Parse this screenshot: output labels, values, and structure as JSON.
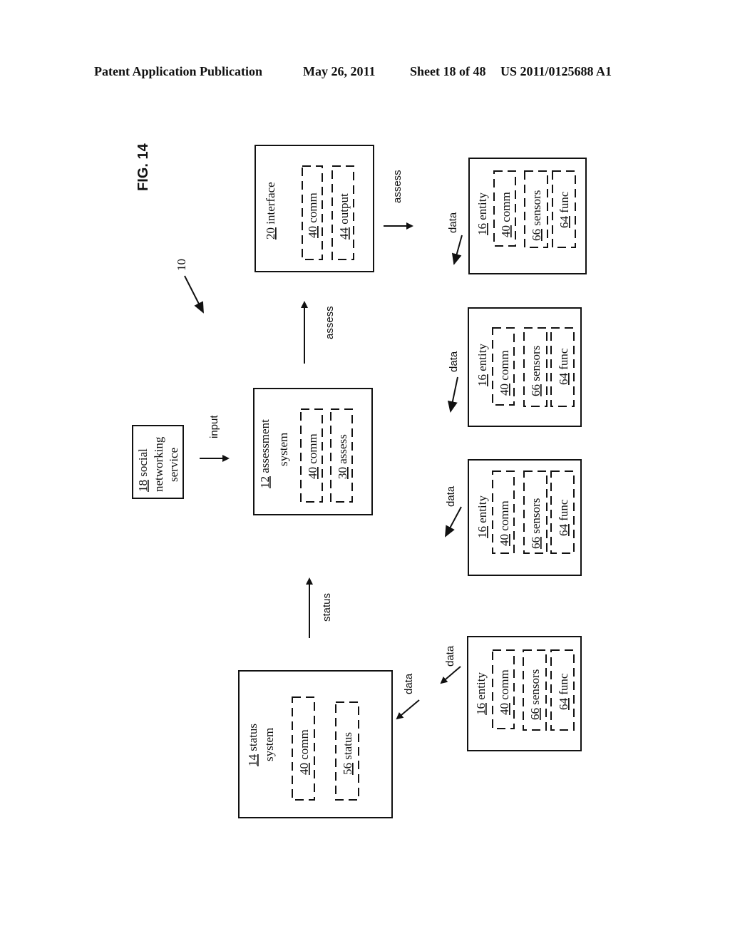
{
  "header": {
    "left": "Patent Application Publication",
    "date": "May 26, 2011",
    "sheet": "Sheet 18 of 48",
    "number": "US 2011/0125688 A1"
  },
  "figure": {
    "label": "FIG. 14",
    "ref": "10"
  },
  "boxes": {
    "interface": {
      "num": "20",
      "text": " interface",
      "subs": [
        {
          "num": "40",
          "text": " comm"
        },
        {
          "num": "44",
          "text": " output"
        }
      ]
    },
    "assessment": {
      "num": "12",
      "text": " assessment",
      "line2": "system",
      "subs": [
        {
          "num": "40",
          "text": " comm"
        },
        {
          "num": "30",
          "text": " assess"
        }
      ]
    },
    "social": {
      "num": "18",
      "text": " social",
      "line2": "networking",
      "line3": "service"
    },
    "status": {
      "num": "14",
      "text": " status",
      "line2": "system",
      "subs": [
        {
          "num": "40",
          "text": " comm"
        },
        {
          "num": "56",
          "text": " status"
        }
      ]
    },
    "entities": [
      {
        "num": "16",
        "text": " entity",
        "subs": [
          {
            "num": "40",
            "text": " comm"
          },
          {
            "num": "66",
            "text": " sensors"
          },
          {
            "num": "64",
            "text": " func"
          }
        ]
      },
      {
        "num": "16",
        "text": " entity",
        "subs": [
          {
            "num": "40",
            "text": " comm"
          },
          {
            "num": "66",
            "text": " sensors"
          },
          {
            "num": "64",
            "text": " func"
          }
        ]
      },
      {
        "num": "16",
        "text": " entity",
        "subs": [
          {
            "num": "40",
            "text": " comm"
          },
          {
            "num": "66",
            "text": " sensors"
          },
          {
            "num": "64",
            "text": " func"
          }
        ]
      },
      {
        "num": "16",
        "text": " entity",
        "subs": [
          {
            "num": "40",
            "text": " comm"
          },
          {
            "num": "66",
            "text": " sensors"
          },
          {
            "num": "64",
            "text": " func"
          }
        ]
      }
    ]
  },
  "arrows": {
    "input": "input",
    "assess_up": "assess",
    "assess_right": "assess",
    "status_up": "status",
    "data": "data"
  }
}
